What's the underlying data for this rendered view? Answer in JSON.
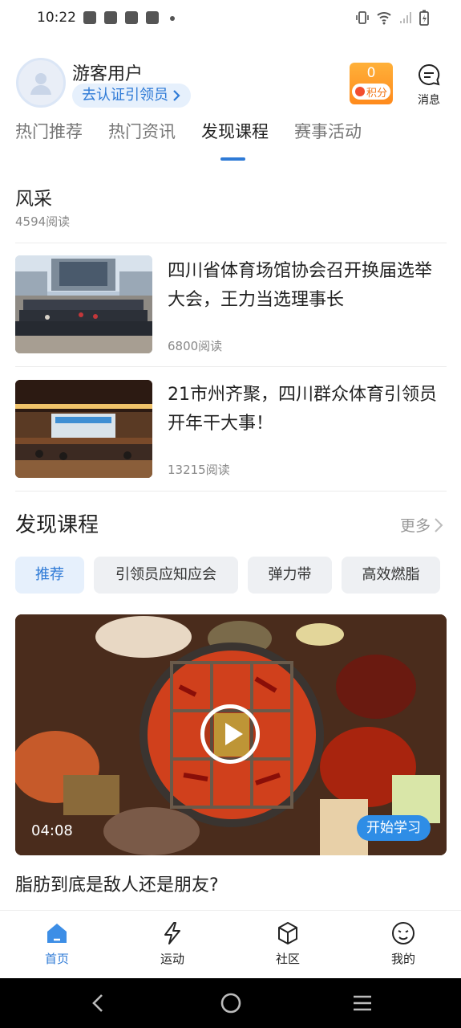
{
  "status_bar": {
    "time": "10:22"
  },
  "header": {
    "username": "游客用户",
    "verify_label": "去认证引领员",
    "points_value": "0",
    "points_label": "积分",
    "message_label": "消息"
  },
  "tabs": [
    {
      "label": "热门推荐",
      "active": false
    },
    {
      "label": "热门资讯",
      "active": false
    },
    {
      "label": "发现课程",
      "active": true
    },
    {
      "label": "赛事活动",
      "active": false
    }
  ],
  "section": {
    "title": "风采",
    "reads": "4594阅读"
  },
  "news": [
    {
      "title": "四川省体育场馆协会召开换届选举大会，王力当选理事长",
      "reads": "6800阅读"
    },
    {
      "title": "21市州齐聚，四川群众体育引领员开年干大事！",
      "reads": "13215阅读"
    }
  ],
  "courses": {
    "title": "发现课程",
    "more_label": "更多",
    "chips": [
      {
        "label": "推荐",
        "active": true
      },
      {
        "label": "引领员应知应会",
        "active": false
      },
      {
        "label": "弹力带",
        "active": false
      },
      {
        "label": "高效燃脂",
        "active": false
      }
    ],
    "video": {
      "duration": "04:08",
      "start_label": "开始学习"
    },
    "caption": "脂肪到底是敌人还是朋友?"
  },
  "bottom_nav": [
    {
      "label": "首页",
      "icon": "home-icon",
      "active": true
    },
    {
      "label": "运动",
      "icon": "lightning-icon",
      "active": false
    },
    {
      "label": "社区",
      "icon": "cube-icon",
      "active": false
    },
    {
      "label": "我的",
      "icon": "face-icon",
      "active": false
    }
  ],
  "colors": {
    "accent": "#2e7ad6",
    "points": "#ff9a26"
  }
}
